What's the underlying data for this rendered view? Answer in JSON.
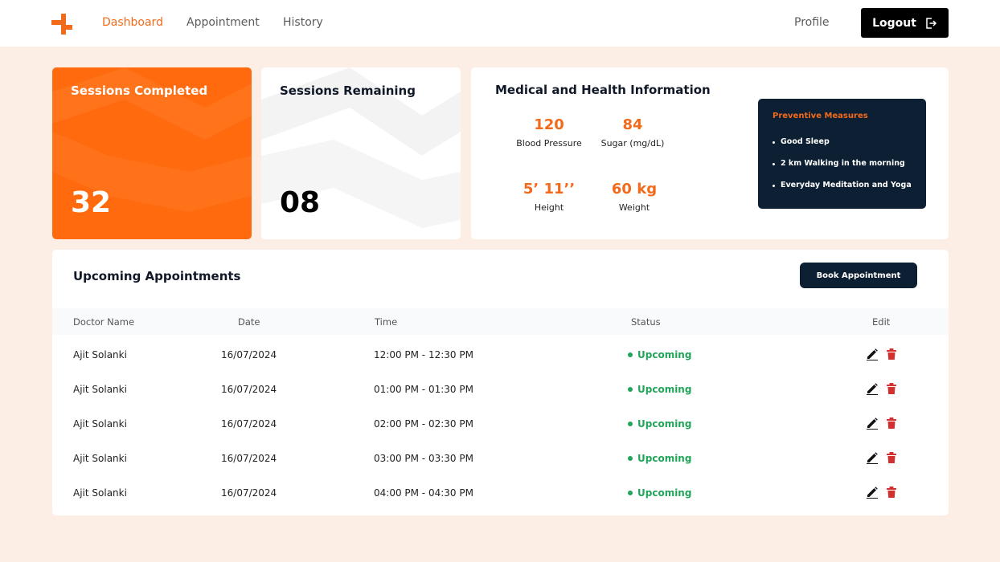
{
  "nav": {
    "links": [
      {
        "label": "Dashboard",
        "active": true
      },
      {
        "label": "Appointment",
        "active": false
      },
      {
        "label": "History",
        "active": false
      }
    ],
    "profile_label": "Profile",
    "logout_label": "Logout"
  },
  "cards": {
    "completed": {
      "title": "Sessions Completed",
      "value": "32"
    },
    "remaining": {
      "title": "Sessions Remaining",
      "value": "08"
    }
  },
  "medical": {
    "title": "Medical and Health Information",
    "metrics": [
      {
        "value": "120",
        "label": "Blood Pressure"
      },
      {
        "value": "84",
        "label": "Sugar (mg/dL)"
      },
      {
        "value": "5’ 11’’",
        "label": "Height"
      },
      {
        "value": "60 kg",
        "label": "Weight"
      }
    ],
    "preventive": {
      "title": "Preventive Measures",
      "items": [
        "Good Sleep",
        "2 km Walking in the morning",
        "Everyday Meditation and Yoga"
      ]
    }
  },
  "appointments": {
    "title": "Upcoming Appointments",
    "book_label": "Book Appointment",
    "columns": [
      "Doctor Name",
      "Date",
      "Time",
      "Status",
      "Edit"
    ],
    "rows": [
      {
        "doctor": "Ajit Solanki",
        "date": "16/07/2024",
        "time": "12:00 PM - 12:30 PM",
        "status": "Upcoming"
      },
      {
        "doctor": "Ajit Solanki",
        "date": "16/07/2024",
        "time": "01:00 PM - 01:30 PM",
        "status": "Upcoming"
      },
      {
        "doctor": "Ajit Solanki",
        "date": "16/07/2024",
        "time": "02:00 PM - 02:30 PM",
        "status": "Upcoming"
      },
      {
        "doctor": "Ajit Solanki",
        "date": "16/07/2024",
        "time": "03:00 PM - 03:30 PM",
        "status": "Upcoming"
      },
      {
        "doctor": "Ajit Solanki",
        "date": "16/07/2024",
        "time": "04:00 PM - 04:30 PM",
        "status": "Upcoming"
      }
    ]
  },
  "colors": {
    "accent": "#f26a1b",
    "completed_card": "#ff6a0f",
    "dark_navy": "#0d1f33",
    "status_green": "#22a55a",
    "delete_red": "#d32f2f",
    "page_bg": "#fdeee5"
  },
  "icons": {
    "logo": "brand-cross-logo",
    "logout": "logout-arrow-icon",
    "edit": "pencil-icon",
    "delete": "trash-icon"
  }
}
